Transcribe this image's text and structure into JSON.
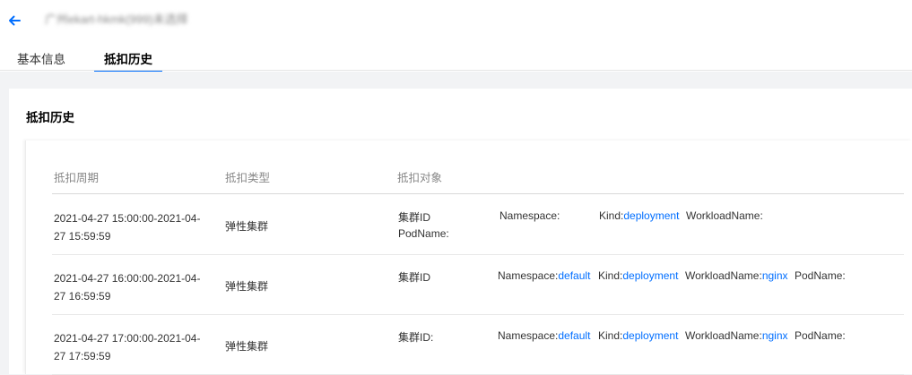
{
  "header": {
    "title": "广州ekart-hkmk(999)未选择",
    "tabs": [
      {
        "label": "基本信息"
      },
      {
        "label": "抵扣历史"
      }
    ]
  },
  "panel": {
    "title": "抵扣历史",
    "columns": [
      "抵扣周期",
      "抵扣类型",
      "抵扣对象"
    ],
    "rows": [
      {
        "period_line1": "2021-04-27 15:00:00-2021-04-",
        "period_line2": "27 15:59:59",
        "type": "弹性集群",
        "cluster_label": "集群ID",
        "namespace_label": "Namespace:",
        "namespace_value": "",
        "kind_label": "Kind:",
        "kind_value": "deployment",
        "workload_label": "WorkloadName:",
        "workload_value": "",
        "pod_label": "PodName:"
      },
      {
        "period_line1": "2021-04-27 16:00:00-2021-04-",
        "period_line2": "27 16:59:59",
        "type": "弹性集群",
        "cluster_label": "集群ID",
        "namespace_label": "Namespace:",
        "namespace_value": "default",
        "kind_label": "Kind:",
        "kind_value": "deployment",
        "workload_label": "WorkloadName:",
        "workload_value": "nginx",
        "pod_label": "PodName:"
      },
      {
        "period_line1": "2021-04-27 17:00:00-2021-04-",
        "period_line2": "27 17:59:59",
        "type": "弹性集群",
        "cluster_label": "集群ID:",
        "namespace_label": "Namespace:",
        "namespace_value": "default",
        "kind_label": "Kind:",
        "kind_value": "deployment",
        "workload_label": "WorkloadName:",
        "workload_value": "nginx",
        "pod_label": "PodName:"
      }
    ]
  },
  "colors": {
    "accent": "#006eff",
    "background": "#f2f3f5"
  },
  "icons": {
    "back": "arrow-left-icon"
  }
}
